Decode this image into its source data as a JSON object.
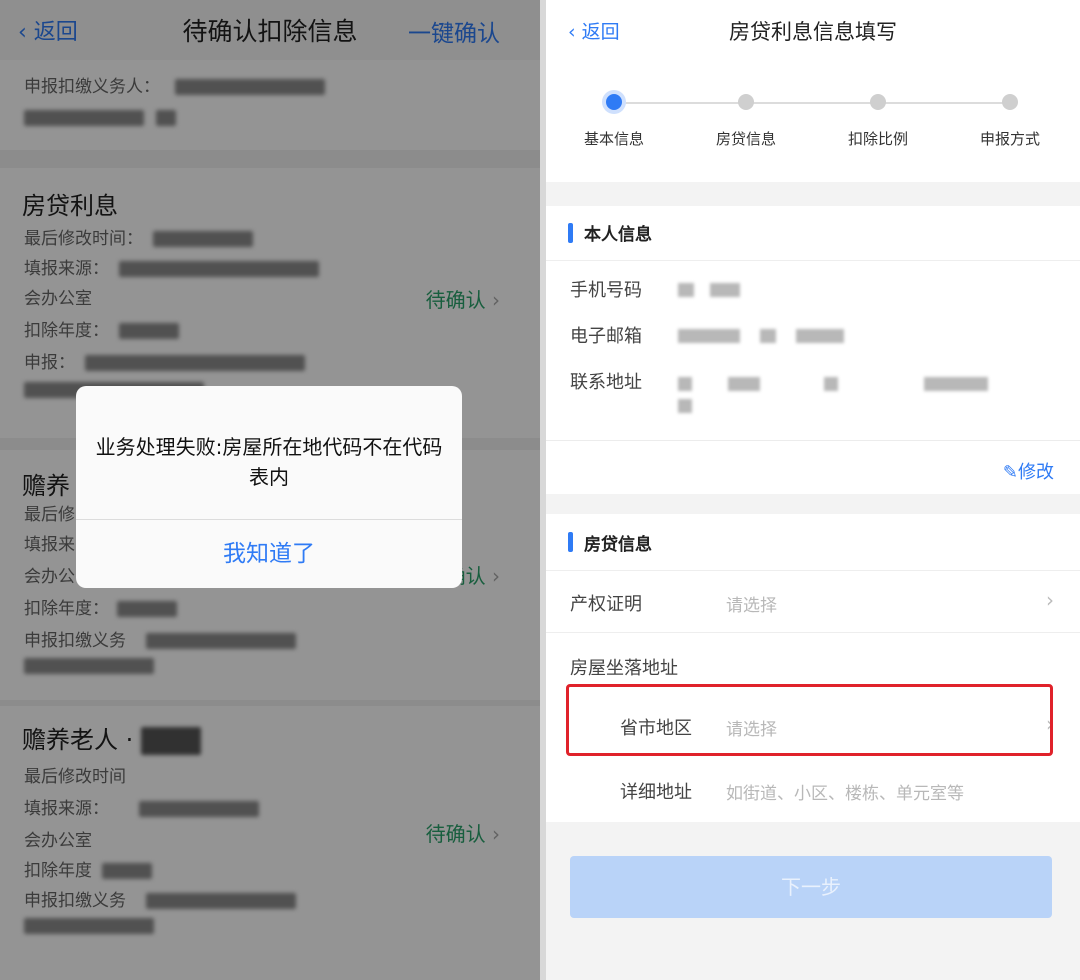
{
  "left": {
    "nav": {
      "back": "返回",
      "title": "待确认扣除信息",
      "confirm_all": "一键确认"
    },
    "top_section": {
      "row": "申报扣缴义务人："
    },
    "mortgage": {
      "heading": "房贷利息",
      "rows": [
        "最后修改时间：",
        "填报来源：",
        "会办公室",
        "扣除年度：",
        "申报："
      ],
      "status": "待确认"
    },
    "elder1": {
      "heading": "赡养",
      "rows": [
        "最后修",
        "填报来",
        "会办公",
        "扣除年度：",
        "申报扣缴义务"
      ],
      "status": "确认"
    },
    "elder2": {
      "heading": "赡养老人",
      "rows": [
        "最后修改时间",
        "填报来源：",
        "会办公室",
        "扣除年度",
        "申报扣缴义务"
      ],
      "status": "待确认"
    },
    "dialog": {
      "message": "业务处理失败:房屋所在地代码不在代码表内",
      "ok": "我知道了"
    }
  },
  "right": {
    "nav": {
      "back": "返回",
      "title": "房贷利息信息填写"
    },
    "steps": [
      "基本信息",
      "房贷信息",
      "扣除比例",
      "申报方式"
    ],
    "active_step": 0,
    "personal": {
      "title": "本人信息",
      "phone_label": "手机号码",
      "email_label": "电子邮箱",
      "address_label": "联系地址",
      "edit": "修改"
    },
    "loan": {
      "title": "房贷信息",
      "property_label": "产权证明",
      "property_placeholder": "请选择",
      "location_label": "房屋坐落地址",
      "region_label": "省市地区",
      "region_placeholder": "请选择",
      "detail_label": "详细地址",
      "detail_placeholder": "如街道、小区、楼栋、单元室等"
    },
    "next": "下一步",
    "accent": "#2f7bf5",
    "highlight": "#e0222a"
  }
}
